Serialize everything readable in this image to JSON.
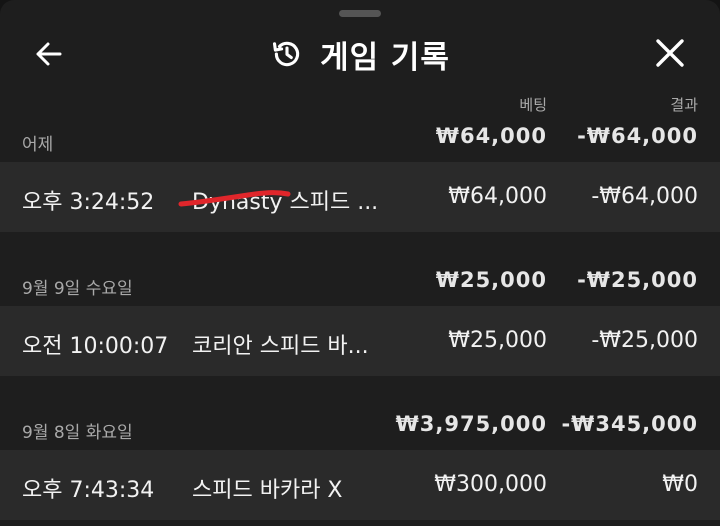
{
  "header": {
    "title": "게임 기록",
    "back_icon": "arrow-left-icon",
    "history_icon": "history-icon",
    "close_icon": "close-icon"
  },
  "columns": {
    "bet": "베팅",
    "result": "결과"
  },
  "groups": [
    {
      "date": "어제",
      "total_bet": "₩64,000",
      "total_result": "-₩64,000",
      "games": [
        {
          "time": "오후 3:24:52",
          "name": "Dynasty 스피드 ...",
          "bet": "₩64,000",
          "result": "-₩64,000"
        }
      ]
    },
    {
      "date": "9월 9일 수요일",
      "total_bet": "₩25,000",
      "total_result": "-₩25,000",
      "games": [
        {
          "time": "오전 10:00:07",
          "name": "코리안 스피드 바...",
          "bet": "₩25,000",
          "result": "-₩25,000"
        }
      ]
    },
    {
      "date": "9월 8일 화요일",
      "total_bet": "₩3,975,000",
      "total_result": "-₩345,000",
      "games": [
        {
          "time": "오후 7:43:34",
          "name": "스피드 바카라 X",
          "bet": "₩300,000",
          "result": "₩0"
        }
      ]
    }
  ],
  "colors": {
    "sheet_bg": "#1e1e1e",
    "row_bg": "#2a2a2a",
    "muted_text": "#a9a9a9",
    "scribble": "#e0262b"
  }
}
